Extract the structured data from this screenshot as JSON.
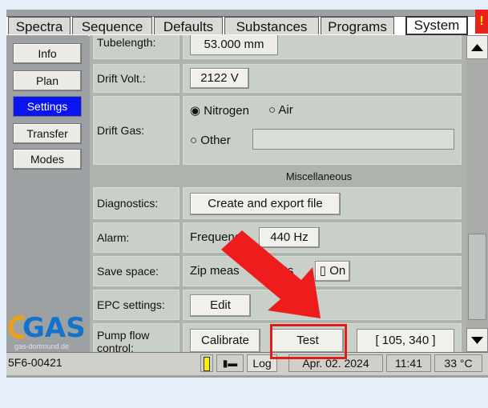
{
  "tabs": [
    "Spectra",
    "Sequence",
    "Defaults",
    "Substances",
    "Programs",
    "System"
  ],
  "warning_mark": "!",
  "sidebar": [
    "Info",
    "Plan",
    "Settings",
    "Transfer",
    "Modes"
  ],
  "rows": {
    "tubelength": {
      "label": "Tubelength:",
      "value": "53.000 mm"
    },
    "drift_volt": {
      "label": "Drift Volt.:",
      "value": "2122 V"
    },
    "drift_gas": {
      "label": "Drift Gas:",
      "opt1": "Nitrogen",
      "opt2": "Air",
      "opt3": "Other",
      "other_value": ""
    },
    "misc_heading": "Miscellaneous",
    "diagnostics": {
      "label": "Diagnostics:",
      "button": "Create and export file"
    },
    "alarm": {
      "label": "Alarm:",
      "text": "Frequenc",
      "value": "440 Hz"
    },
    "save_space": {
      "label": "Save space:",
      "text": "Zip meas",
      "text2": "ts",
      "toggle": "On"
    },
    "epc": {
      "label": "EPC settings:",
      "button": "Edit"
    },
    "pump": {
      "label": "Pump flow control:",
      "calibrate": "Calibrate",
      "test": "Test",
      "readout": "[ 105, 340 ]"
    }
  },
  "logo": {
    "text": "GAS",
    "sub": "gas-dortmund.de"
  },
  "status": {
    "device": "5F6-00421",
    "log": "Log",
    "date": "Apr. 02. 2024",
    "time": "11:41",
    "temp": "33 °C"
  },
  "colors": {
    "accent": "#0a14f0",
    "highlight": "#e31b1b",
    "logo": "#1473c8"
  }
}
